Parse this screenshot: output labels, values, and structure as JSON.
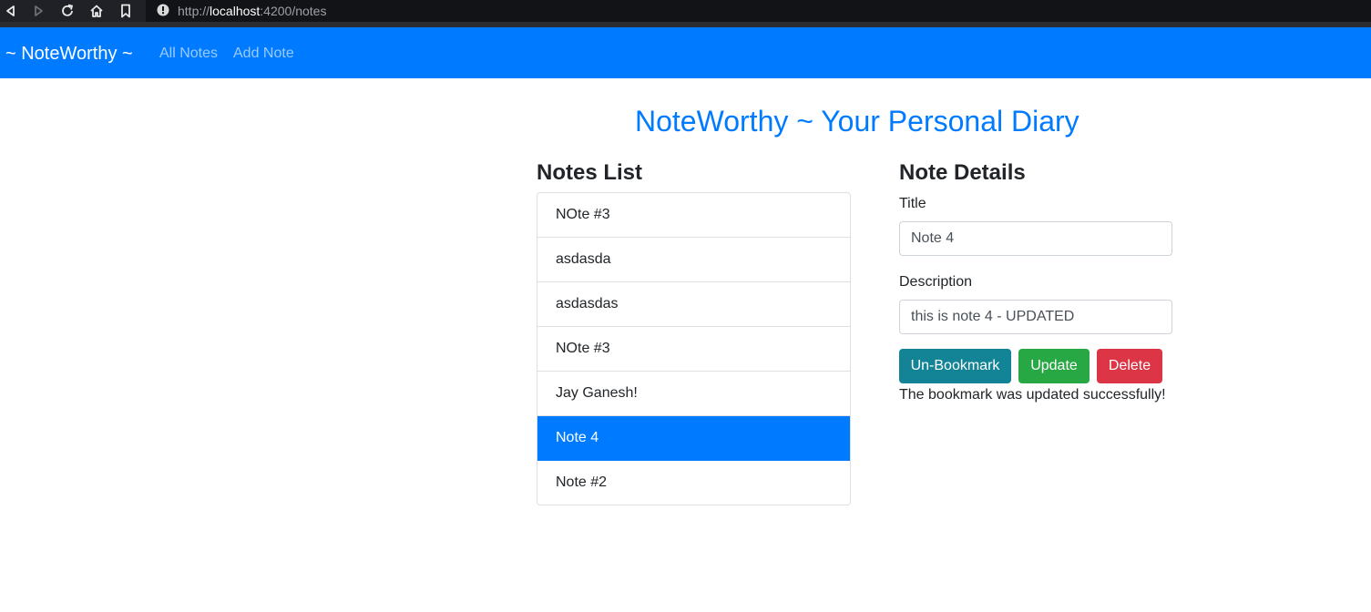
{
  "browser": {
    "url_scheme": "http://",
    "url_host": "localhost",
    "url_path": ":4200/notes",
    "icons": [
      "back-icon",
      "forward-icon",
      "reload-icon",
      "home-icon",
      "bookmark-icon",
      "info-icon"
    ]
  },
  "navbar": {
    "brand": "~ NoteWorthy ~",
    "links": [
      "All Notes",
      "Add Note"
    ]
  },
  "page": {
    "title": "NoteWorthy ~ Your Personal Diary"
  },
  "notes_list": {
    "heading": "Notes List",
    "items": [
      "NOte #3",
      "asdasda",
      "asdasdas",
      "NOte #3",
      "Jay Ganesh!",
      "Note 4",
      "Note #2"
    ],
    "selected_index": 5
  },
  "note_details": {
    "heading": "Note Details",
    "title_label": "Title",
    "title_value": "Note 4",
    "description_label": "Description",
    "description_value": "this is note 4 - UPDATED",
    "buttons": {
      "bookmark": "Un-Bookmark",
      "update": "Update",
      "delete": "Delete"
    },
    "status_message": "The bookmark was updated successfully!"
  },
  "colors": {
    "primary": "#007bff",
    "info": "#138496",
    "success": "#28a745",
    "danger": "#dc3545"
  }
}
